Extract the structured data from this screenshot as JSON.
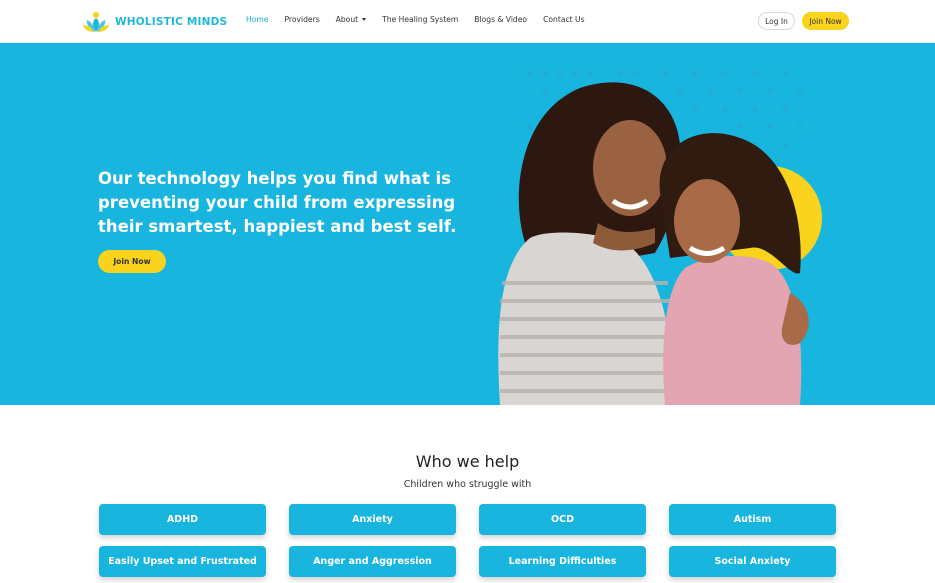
{
  "brand": {
    "name": "WHOLISTIC MINDS"
  },
  "nav": {
    "items": [
      {
        "label": "Home"
      },
      {
        "label": "Providers"
      },
      {
        "label": "About"
      },
      {
        "label": "The Healing System"
      },
      {
        "label": "Blogs & Video"
      },
      {
        "label": "Contact Us"
      }
    ],
    "login_label": "Log In",
    "join_label": "Join Now"
  },
  "hero": {
    "heading": "Our technology helps you find what is preventing your child from expressing their smartest, happiest and best self.",
    "cta_label": "Join Now"
  },
  "help": {
    "title": "Who we help",
    "subtitle": "Children who struggle with",
    "conditions": [
      "ADHD",
      "Anxiety",
      "OCD",
      "Autism",
      "Easily Upset and Frustrated",
      "Anger and Aggression",
      "Learning Difficulties",
      "Social Anxiety"
    ]
  },
  "colors": {
    "brand_blue": "#18b5de",
    "accent_yellow": "#f9d31c"
  }
}
